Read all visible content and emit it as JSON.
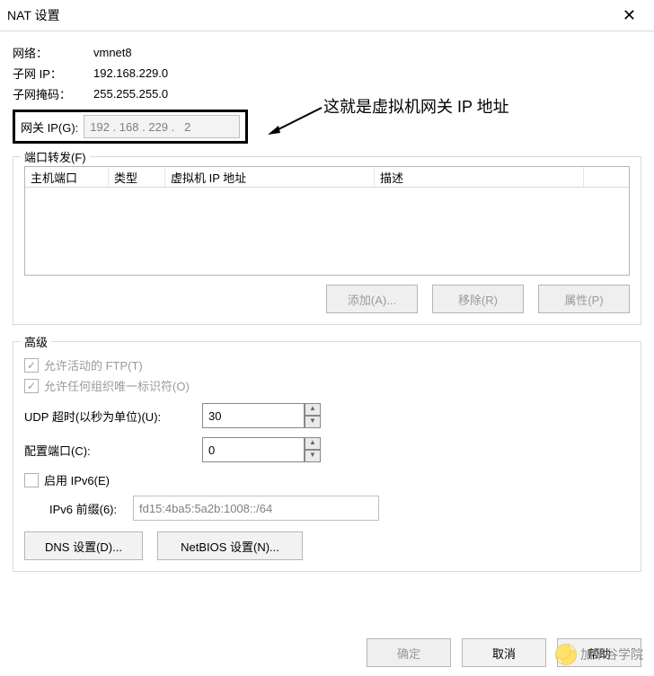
{
  "window": {
    "title": "NAT 设置"
  },
  "network_info": {
    "network_label": "网络：",
    "network_value": "vmnet8",
    "subnet_ip_label": "子网 IP：",
    "subnet_ip_value": "192.168.229.0",
    "subnet_mask_label": "子网掩码：",
    "subnet_mask_value": "255.255.255.0",
    "gateway_label": "网关 IP(G):",
    "gateway_value": "192 . 168 . 229 .   2"
  },
  "annotation": {
    "text": "这就是虚拟机网关 IP 地址"
  },
  "port_forward": {
    "group_title": "端口转发(F)",
    "columns": {
      "c1": "主机端口",
      "c2": "类型",
      "c3": "虚拟机 IP 地址",
      "c4": "描述"
    },
    "buttons": {
      "add": "添加(A)...",
      "remove": "移除(R)",
      "props": "属性(P)"
    }
  },
  "advanced": {
    "group_title": "高级",
    "allow_active_ftp": "允许活动的 FTP(T)",
    "allow_org_oui": "允许任何组织唯一标识符(O)",
    "udp_timeout_label": "UDP 超时(以秒为单位)(U):",
    "udp_timeout_value": "30",
    "config_port_label": "配置端口(C):",
    "config_port_value": "0",
    "enable_ipv6": "启用 IPv6(E)",
    "ipv6_prefix_label": "IPv6 前缀(6):",
    "ipv6_prefix_value": "fd15:4ba5:5a2b:1008::/64",
    "dns_btn": "DNS 设置(D)...",
    "netbios_btn": "NetBIOS 设置(N)..."
  },
  "footer": {
    "ok": "确定",
    "cancel": "取消",
    "help": "帮助"
  },
  "publisher": {
    "name": "加米谷学院"
  }
}
